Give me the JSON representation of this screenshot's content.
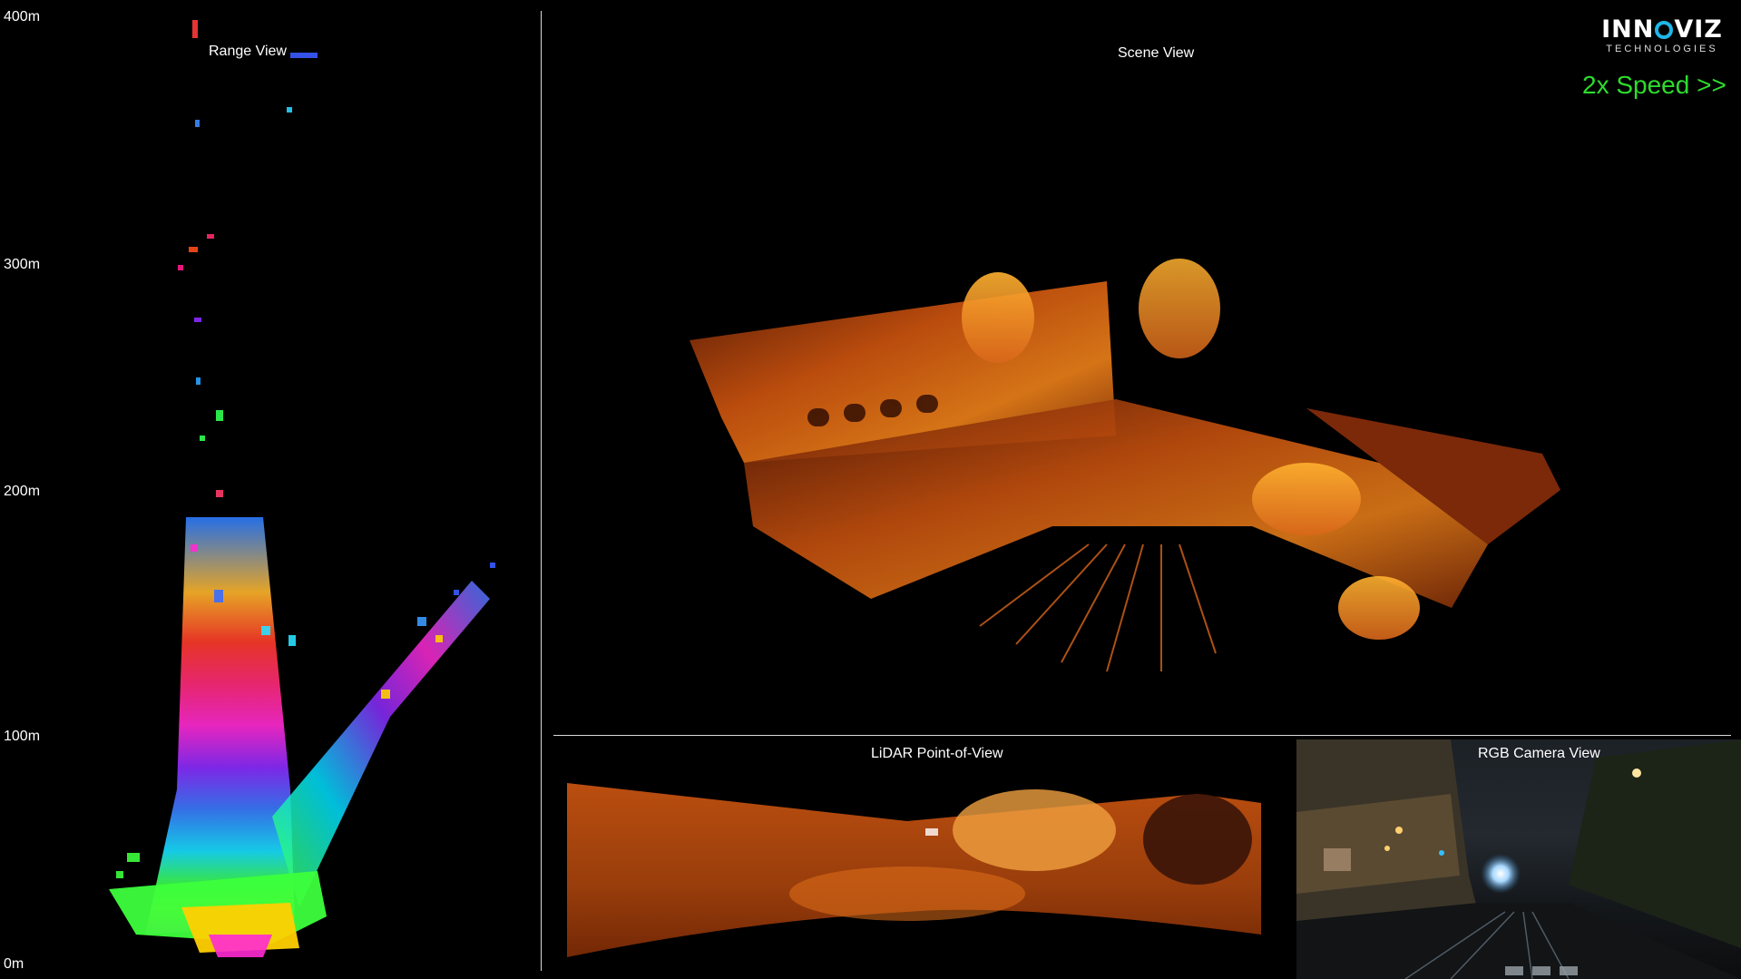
{
  "range_view": {
    "title": "Range View",
    "axis_labels": [
      "400m",
      "300m",
      "200m",
      "100m",
      "0m"
    ]
  },
  "scene_view": {
    "title": "Scene View"
  },
  "brand": {
    "logo_text": "INNOVIZ",
    "logo_subtext": "TECHNOLOGIES",
    "accent_color": "#1fb6e8"
  },
  "playback": {
    "speed_label": "2x Speed >>",
    "speed_color": "#2ddc2d"
  },
  "lidar_pov": {
    "title": "LiDAR Point-of-View"
  },
  "camera_view": {
    "title": "RGB Camera View"
  }
}
